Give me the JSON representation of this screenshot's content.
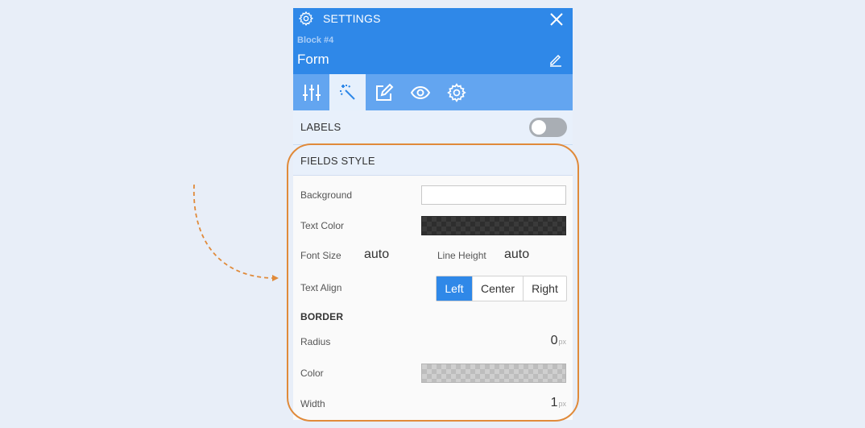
{
  "header": {
    "title": "SETTINGS",
    "block_id": "Block #4",
    "block_name": "Form"
  },
  "tabs": [
    {
      "name": "sliders",
      "active": false
    },
    {
      "name": "magic-wand",
      "active": true
    },
    {
      "name": "edit",
      "active": false
    },
    {
      "name": "eye",
      "active": false
    },
    {
      "name": "gear",
      "active": false
    }
  ],
  "labels_row": {
    "label": "LABELS",
    "toggle_on": false
  },
  "fields_style": {
    "heading": "FIELDS STYLE",
    "background_label": "Background",
    "text_color_label": "Text Color",
    "font_size_label": "Font Size",
    "font_size_value": "auto",
    "line_height_label": "Line Height",
    "line_height_value": "auto",
    "text_align_label": "Text Align",
    "align_options": [
      "Left",
      "Center",
      "Right"
    ],
    "align_selected": "Left"
  },
  "border": {
    "heading": "BORDER",
    "radius_label": "Radius",
    "radius_value": "0",
    "radius_unit": "px",
    "color_label": "Color",
    "width_label": "Width",
    "width_value": "1",
    "width_unit": "px"
  },
  "colors": {
    "header_blue": "#2f88e8",
    "tab_bar_blue": "#63a5f0",
    "highlight_orange": "#e08a3a",
    "background_swatch": "#ffffff",
    "text_color_swatch": "#333333"
  }
}
